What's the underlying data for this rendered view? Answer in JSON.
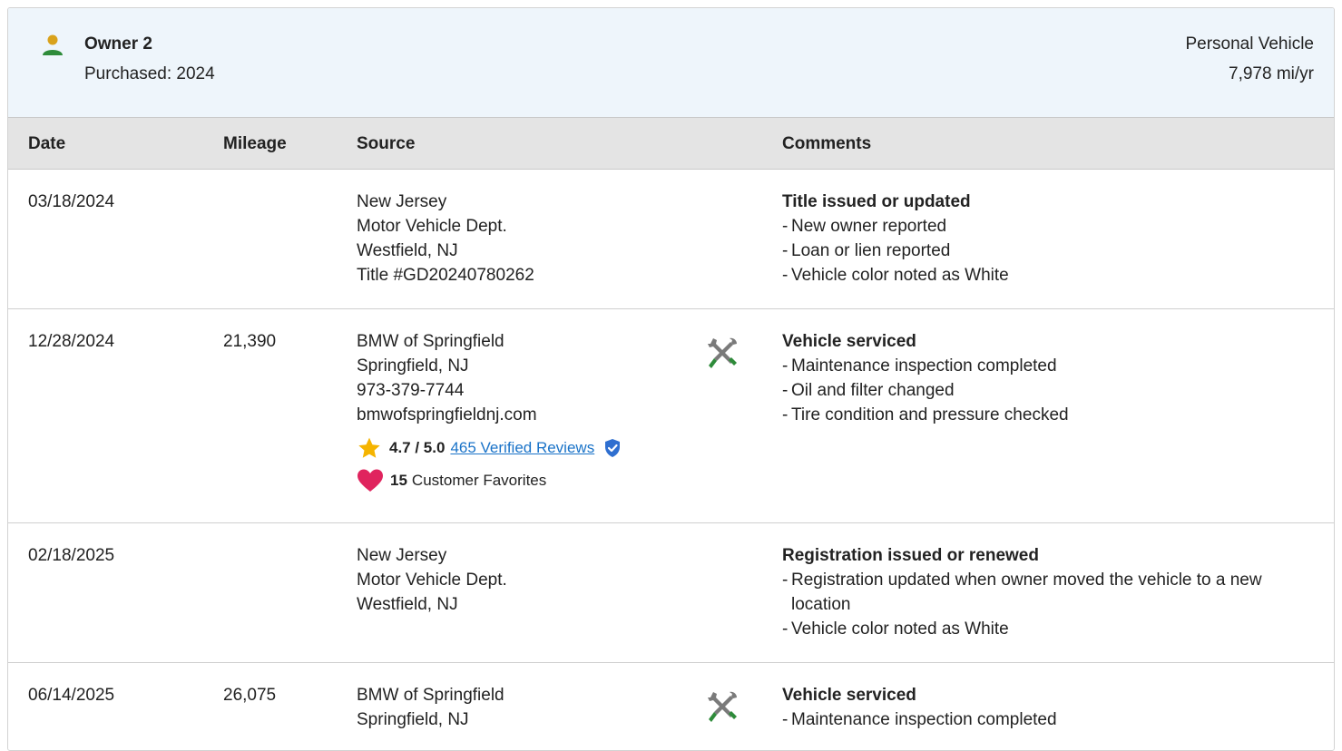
{
  "owner": {
    "name": "Owner 2",
    "purchased": "Purchased: 2024",
    "vehicle_type": "Personal Vehicle",
    "miles_per_year": "7,978 mi/yr"
  },
  "columns": {
    "date": "Date",
    "mileage": "Mileage",
    "source": "Source",
    "comments": "Comments"
  },
  "records": [
    {
      "date": "03/18/2024",
      "mileage": "",
      "source": [
        "New Jersey",
        "Motor Vehicle Dept.",
        "Westfield, NJ",
        "Title #GD20240780262"
      ],
      "comment_title": "Title issued or updated",
      "comment_items": [
        "New owner reported",
        "Loan or lien reported",
        "Vehicle color noted as White"
      ]
    },
    {
      "date": "12/28/2024",
      "mileage": "21,390",
      "source": [
        "BMW of Springfield",
        "Springfield, NJ",
        "973-379-7744",
        "bmwofspringfieldnj.com"
      ],
      "rating": "4.7 / 5.0",
      "reviews_link": "465 Verified Reviews",
      "favorites_count": "15",
      "favorites_label": "Customer Favorites",
      "icon": "service-wrench-icon",
      "comment_title": "Vehicle serviced",
      "comment_items": [
        "Maintenance inspection completed",
        "Oil and filter changed",
        "Tire condition and pressure checked"
      ]
    },
    {
      "date": "02/18/2025",
      "mileage": "",
      "source": [
        "New Jersey",
        "Motor Vehicle Dept.",
        "Westfield, NJ"
      ],
      "comment_title": "Registration issued or renewed",
      "comment_items": [
        "Registration updated when owner moved the vehicle to a new location",
        "Vehicle color noted as White"
      ]
    },
    {
      "date": "06/14/2025",
      "mileage": "26,075",
      "source": [
        "BMW of Springfield",
        "Springfield, NJ"
      ],
      "icon": "service-wrench-icon",
      "comment_title": "Vehicle serviced",
      "comment_items": [
        "Maintenance inspection completed"
      ]
    }
  ],
  "colors": {
    "header_bg": "#eef5fb",
    "table_head_bg": "#e4e4e4",
    "link": "#1a73c8",
    "star": "#f5b400",
    "heart": "#e0245e",
    "wrench_green": "#2e8b3a",
    "verified_badge": "#2f6fd0",
    "owner_icon_body": "#2e8b3a",
    "owner_icon_head": "#d9a21b"
  }
}
